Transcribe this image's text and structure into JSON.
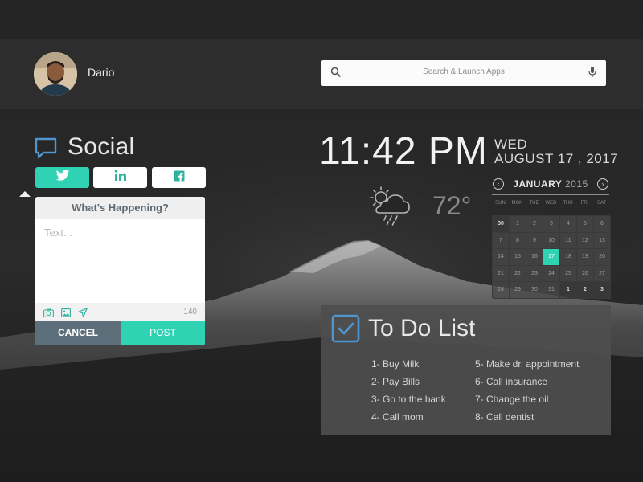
{
  "user": {
    "name": "Dario"
  },
  "search": {
    "placeholder": "Search & Launch Apps"
  },
  "social": {
    "title": "Social",
    "networks": [
      {
        "name": "twitter",
        "icon": "twitter-icon",
        "active": true
      },
      {
        "name": "linkedin",
        "icon": "linkedin-icon",
        "active": false
      },
      {
        "name": "facebook",
        "icon": "facebook-icon",
        "active": false
      }
    ],
    "card_title": "What's Happening?",
    "text_placeholder": "Text...",
    "char_count": "140",
    "cancel_label": "CANCEL",
    "post_label": "POST"
  },
  "clock": {
    "time": "11:42 PM",
    "day": "WED",
    "date": "AUGUST 17  , 2017"
  },
  "weather": {
    "icon": "rain-cloud-icon",
    "temp": "72°"
  },
  "calendar": {
    "month": "JANUARY",
    "year": "2015",
    "prev_icon": "chevron-left-icon",
    "next_icon": "chevron-right-icon",
    "dow": [
      "SUN",
      "MON",
      "TUE",
      "WED",
      "THU",
      "FRI",
      "SAT"
    ],
    "days": [
      {
        "d": "30",
        "out": true
      },
      {
        "d": "1"
      },
      {
        "d": "2"
      },
      {
        "d": "3"
      },
      {
        "d": "4"
      },
      {
        "d": "5"
      },
      {
        "d": "6"
      },
      {
        "d": "7"
      },
      {
        "d": "8"
      },
      {
        "d": "9"
      },
      {
        "d": "10"
      },
      {
        "d": "11"
      },
      {
        "d": "12"
      },
      {
        "d": "13"
      },
      {
        "d": "14"
      },
      {
        "d": "15"
      },
      {
        "d": "16"
      },
      {
        "d": "17",
        "today": true
      },
      {
        "d": "18"
      },
      {
        "d": "19"
      },
      {
        "d": "20"
      },
      {
        "d": "21"
      },
      {
        "d": "22"
      },
      {
        "d": "23"
      },
      {
        "d": "24"
      },
      {
        "d": "25"
      },
      {
        "d": "26"
      },
      {
        "d": "27"
      },
      {
        "d": "28"
      },
      {
        "d": "29"
      },
      {
        "d": "30"
      },
      {
        "d": "31"
      },
      {
        "d": "1",
        "out": true
      },
      {
        "d": "2",
        "out": true
      },
      {
        "d": "3",
        "out": true
      }
    ]
  },
  "todo": {
    "title": "To Do List",
    "items": [
      "1- Buy Milk",
      "2- Pay Bills",
      "3- Go to the bank",
      "4- Call mom",
      "5- Make dr. appointment",
      "6- Call insurance",
      "7- Change the oil",
      "8- Call dentist"
    ]
  },
  "colors": {
    "accent": "#2fd3b3",
    "cancel": "#5d6f7b",
    "bg": "#262626"
  }
}
